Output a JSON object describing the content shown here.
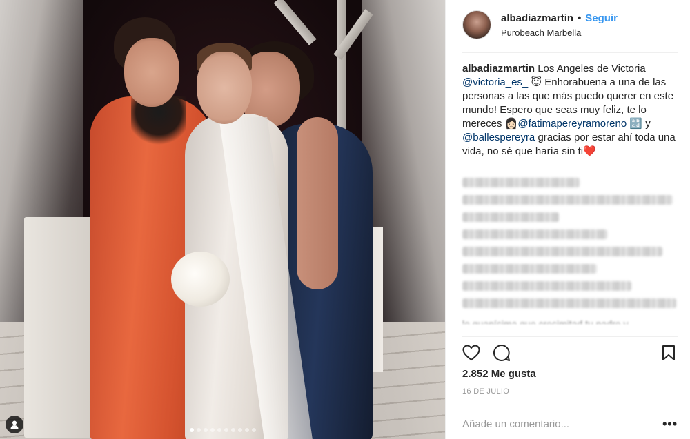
{
  "post": {
    "username": "albadiazmartin",
    "separator": "•",
    "follow_label": "Seguir",
    "location": "Purobeach Marbella",
    "caption": {
      "username": "albadiazmartin",
      "text_1": " Los Angeles de Victoria ",
      "mention_1": "@victoria_es_",
      "emoji_1": " 😇",
      "text_2": " Enhorabuena a una de las personas a las que más puedo querer en este mundo! Espero que seas muy feliz, te lo mereces ",
      "emoji_2": "👩🏻",
      "mention_2": "@fatimapereyramoreno",
      "emoji_3": " 🔡",
      "text_3": " y ",
      "mention_3": "@ballespereyra",
      "text_4": " gracias por estar ahí toda una vida, no sé que haría sin ti",
      "emoji_4": "❤️"
    },
    "blurred_cutoff_text": "le guapísima que cresimitad tu padre y",
    "likes_label": "2.852 Me gusta",
    "date_label": "16 DE JULIO",
    "comment_placeholder": "Añade un comentario...",
    "more_label": "•••"
  },
  "carousel": {
    "total": 10,
    "active_index": 0
  },
  "colors": {
    "link": "#3897f0",
    "mention": "#003569",
    "muted": "#999999"
  },
  "icons": {
    "like": "heart-icon",
    "comment": "comment-icon",
    "save": "bookmark-icon",
    "tag": "user-tag-icon"
  }
}
